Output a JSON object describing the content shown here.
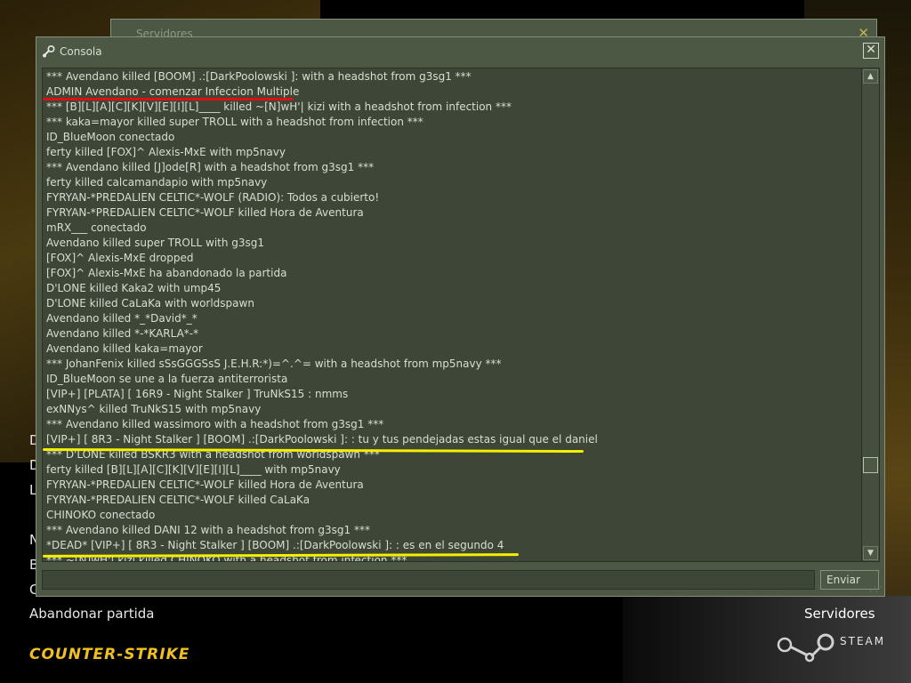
{
  "windows": {
    "back_title": "Servidores",
    "console_title": "Consola",
    "close_glyph": "✕"
  },
  "log": [
    "*** Avendano killed [BOOM] .:[DarkPoolowski ]: with a headshot from g3sg1 ***",
    "ADMIN Avendano - comenzar Infeccion Multiple",
    "*** [B][L][A][C][K][V][E][I][L]____ killed ~[N]wH'| kizi with a headshot from infection ***",
    "*** kaka=mayor killed super TROLL with a headshot from infection ***",
    "ID_BlueMoon conectado",
    "ferty killed [FOX]^ Alexis-MxE with mp5navy",
    "*** Avendano killed [J]ode[R] with a headshot from g3sg1 ***",
    "ferty killed calcamandapio with mp5navy",
    "FYRYAN-*PREDALIEN CELTIC*-WOLF (RADIO): Todos a cubierto!",
    "FYRYAN-*PREDALIEN CELTIC*-WOLF killed Hora de Aventura",
    "mRX___ conectado",
    "Avendano killed super TROLL with g3sg1",
    "[FOX]^ Alexis-MxE dropped",
    "[FOX]^ Alexis-MxE ha abandonado la partida",
    "D'LONE killed Kaka2 with ump45",
    "D'LONE killed CaLaKa with worldspawn",
    "Avendano killed *_*David*_*",
    "Avendano killed *-*KARLA*-*",
    "Avendano killed kaka=mayor",
    "*** JohanFenix killed sSsGGGSsS J.E.H.R:*)=^.^= with a headshot from mp5navy ***",
    "ID_BlueMoon se une a la fuerza antiterrorista",
    "[VIP+] [PLATA] [ 16R9 - Night Stalker ] TruNkS15 : nmms",
    "exNNys^ killed TruNkS15 with mp5navy",
    "*** Avendano killed wassimoro with a headshot from g3sg1 ***",
    "[VIP+] [ 8R3 - Night Stalker ] [BOOM] .:[DarkPoolowski ]: : tu y tus pendejadas estas igual que el daniel",
    "*** D'LONE killed BSKR3 with a headshot from worldspawn ***",
    "ferty killed [B][L][A][C][K][V][E][I][L]____ with mp5navy",
    "FYRYAN-*PREDALIEN CELTIC*-WOLF killed Hora de Aventura",
    "FYRYAN-*PREDALIEN CELTIC*-WOLF killed CaLaKa",
    "CHINOKO conectado",
    "*** Avendano killed DANI 12 with a headshot from g3sg1 ***",
    "*DEAD* [VIP+] [ 8R3 - Night Stalker ] [BOOM] .:[DarkPoolowski ]: : es en el segundo 4",
    "*** ~[N]wH'| kizi killed CHINOKO with a headshot from infection ***"
  ],
  "input": {
    "value": "",
    "send_label": "Enviar"
  },
  "menu": {
    "abandon": "Abandonar partida",
    "partial_letters": [
      "D",
      "L",
      "N",
      "B",
      "C"
    ],
    "servers": "Servidores"
  },
  "branding": {
    "steam": "STEAM",
    "cs_logo": "COUNTER-STRIKE"
  },
  "colors": {
    "red_mark": "#e01010",
    "yellow_mark": "#f4f000",
    "panel": "#4c5844"
  }
}
